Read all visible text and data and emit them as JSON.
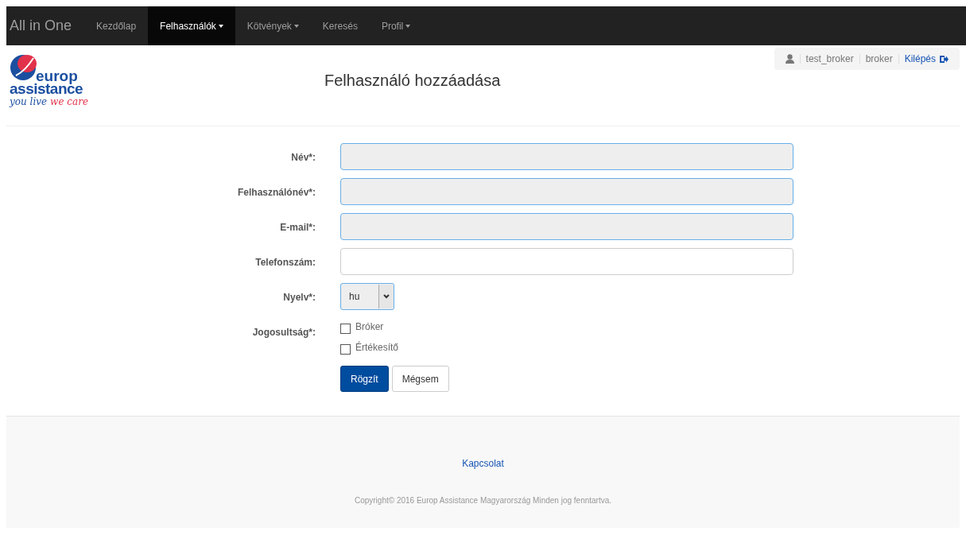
{
  "navbar": {
    "brand": "All in One",
    "items": [
      {
        "label": "Kezdőlap",
        "dropdown": false,
        "selected": false
      },
      {
        "label": "Felhasználók",
        "dropdown": true,
        "selected": true
      },
      {
        "label": "Kötvények",
        "dropdown": true,
        "selected": false
      },
      {
        "label": "Keresés",
        "dropdown": false,
        "selected": false
      },
      {
        "label": "Profil",
        "dropdown": true,
        "selected": false
      }
    ]
  },
  "logo": {
    "line_1": "europ",
    "line_2": "assistance",
    "tagline_1": "you live",
    "tagline_2": "we care"
  },
  "page_title": "Felhasználó hozzáadása",
  "user_bar": {
    "username": "test_broker",
    "role": "broker",
    "logout": "Kilépés"
  },
  "form": {
    "fields": [
      {
        "kind": "text",
        "label": "Név*:",
        "disabled": true
      },
      {
        "kind": "text",
        "label": "Felhasználónév*:",
        "disabled": true
      },
      {
        "kind": "text",
        "label": "E-mail*:",
        "disabled": true
      },
      {
        "kind": "text",
        "label": "Telefonszám:",
        "disabled": false
      },
      {
        "kind": "select",
        "label": "Nyelv*:",
        "value": "hu"
      },
      {
        "kind": "checkboxes",
        "label": "Jogosultság*:",
        "options": [
          {
            "label": "Bróker",
            "checked": false
          },
          {
            "label": "Értékesítő",
            "checked": false
          }
        ]
      }
    ],
    "buttons": [
      {
        "kind": "primary",
        "label": "Rögzít"
      },
      {
        "kind": "default",
        "label": "Mégsem"
      }
    ]
  },
  "footer": {
    "link": "Kapcsolat",
    "copyright": "Copyright© 2016 Europ Assistance Magyarország Minden jog fenntartva."
  }
}
